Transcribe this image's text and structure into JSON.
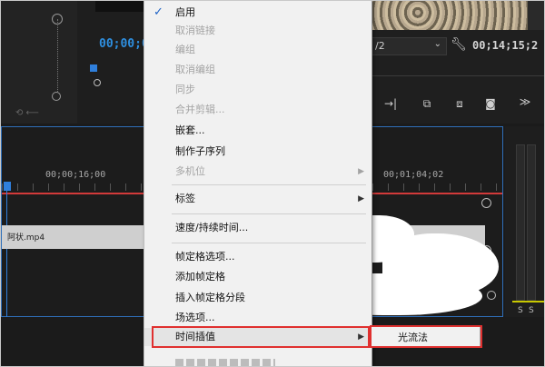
{
  "monitor": {
    "left_timecode": "00;00;0",
    "right_timecode": "00;14;15;2",
    "fraction": "/2"
  },
  "timeline": {
    "ruler_left": "00;00;16;00",
    "ruler_right": "00;01;04;02",
    "clip_label": "阿状.mp4",
    "track_letters": [
      "S",
      "S"
    ]
  },
  "context_menu": {
    "items": [
      {
        "label": "启用",
        "checked": true,
        "enabled": true
      },
      {
        "label": "取消链接",
        "enabled": false
      },
      {
        "label": "编组",
        "enabled": false
      },
      {
        "label": "取消编组",
        "enabled": false
      },
      {
        "label": "同步",
        "enabled": false
      },
      {
        "label": "合并剪辑...",
        "enabled": false
      },
      {
        "label": "嵌套...",
        "enabled": true
      },
      {
        "label": "制作子序列",
        "enabled": true
      },
      {
        "label": "多机位",
        "enabled": false,
        "submenu": true
      },
      {
        "label": "标签",
        "enabled": true,
        "submenu": true
      },
      {
        "label": "速度/持续时间...",
        "enabled": true
      },
      {
        "label": "帧定格选项...",
        "enabled": true
      },
      {
        "label": "添加帧定格",
        "enabled": true
      },
      {
        "label": "插入帧定格分段",
        "enabled": true
      },
      {
        "label": "场选项...",
        "enabled": true
      },
      {
        "label": "时间插值",
        "enabled": true,
        "submenu": true,
        "highlighted": true
      }
    ],
    "check_glyph": "✓",
    "submenu_arrow": "▶"
  },
  "submenu": {
    "items": [
      {
        "label": "光流法"
      }
    ]
  },
  "colors": {
    "timecode_blue": "#2e8fe0",
    "playhead_blue": "#2f7fdc",
    "highlight_red": "#e0302f",
    "track_yellow": "#c8c800",
    "in_out_red": "#d23a3a"
  },
  "icons": [
    "wrench-icon",
    "arrow-right-icon",
    "lift-icon",
    "extract-icon",
    "camera-icon",
    "more-icon",
    "circle-icon",
    "scroll-handle-icon"
  ]
}
